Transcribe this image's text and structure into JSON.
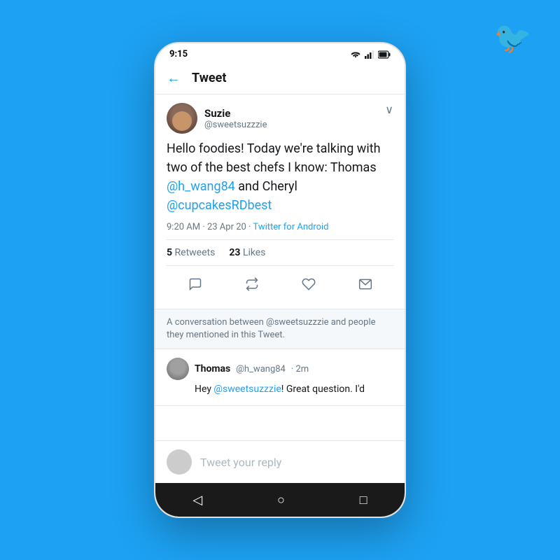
{
  "background_color": "#1da1f2",
  "twitter_logo": "🐦",
  "phone": {
    "status_bar": {
      "time": "9:15",
      "icons": "▼ ▲ 🔋"
    },
    "header": {
      "back_label": "←",
      "title": "Tweet"
    },
    "tweet": {
      "user": {
        "name": "Suzie",
        "handle": "@sweetsuzzzie"
      },
      "text_plain": "Hello foodies! Today we're talking with two of the best chefs I know: Thomas ",
      "mention1": "@h_wang84",
      "text_middle": " and Cheryl ",
      "mention2": "@cupcakesRDbest",
      "timestamp": "9:20 AM · 23 Apr 20 · ",
      "source": "Twitter for Android",
      "retweets_count": "5",
      "retweets_label": "Retweets",
      "likes_count": "23",
      "likes_label": "Likes"
    },
    "conversation_notice": "A conversation between @sweetsuzzzie and people they mentioned in this Tweet.",
    "reply": {
      "user_name": "Thomas",
      "handle": "@h_wang84",
      "time": "· 2m",
      "text_plain": "Hey ",
      "mention": "@sweetsuzzzie",
      "text_rest": "! Great question. I'd"
    },
    "reply_input": {
      "placeholder": "Tweet your reply"
    },
    "actions": {
      "comment": "💬",
      "retweet": "🔁",
      "like": "♡",
      "share": "✉"
    },
    "nav": {
      "back": "◁",
      "home": "○",
      "recent": "□"
    }
  }
}
